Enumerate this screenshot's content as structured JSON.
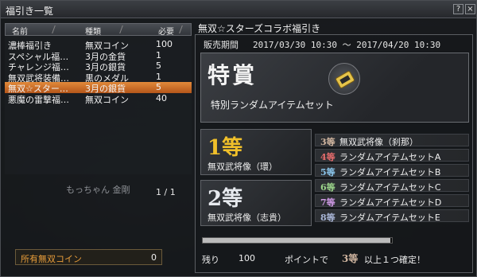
{
  "window": {
    "title": "福引き一覧",
    "help_label": "?",
    "close_label": "×"
  },
  "list": {
    "headers": {
      "name": "名前",
      "type": "種類",
      "required": "必要"
    },
    "rows": [
      {
        "name": "濃棒福引き",
        "type": "無双コイン",
        "required": "100",
        "selected": false
      },
      {
        "name": "スペシャル福…",
        "type": "3月の金貨",
        "required": "1",
        "selected": false
      },
      {
        "name": "チャレンジ福…",
        "type": "3月の銀貨",
        "required": "5",
        "selected": false
      },
      {
        "name": "無双武将装備…",
        "type": "黒のメダル",
        "required": "1",
        "selected": false
      },
      {
        "name": "無双☆スター…",
        "type": "3月の銀貨",
        "required": "5",
        "selected": true
      },
      {
        "name": "悪魔の雷撃福…",
        "type": "無双コイン",
        "required": "40",
        "selected": false
      }
    ],
    "pager": "1 / 1",
    "background_text": "もっちゃん 金剛"
  },
  "coins": {
    "label": "所有無双コイン",
    "value": "0"
  },
  "detail": {
    "title": "無双☆スターズコラボ福引き",
    "period_label": "販売期間",
    "period_value": "2017/03/30 10:30 〜 2017/04/20 10:30",
    "special": {
      "title": "特賞",
      "item": "特別ランダムアイテムセット"
    },
    "first": {
      "rank": "1等",
      "item": "無双武将像（環）",
      "color": "#f0c02a"
    },
    "second": {
      "rank": "2等",
      "item": "無双武将像（志貴）",
      "color": "#e6e9ee"
    },
    "subs": [
      {
        "rank": "3等",
        "item": "無双武将像（刹那）",
        "color": "#d1b6a0"
      },
      {
        "rank": "4等",
        "item": "ランダムアイテムセットA",
        "color": "#e56c6c"
      },
      {
        "rank": "5等",
        "item": "ランダムアイテムセットB",
        "color": "#8bc6ec"
      },
      {
        "rank": "6等",
        "item": "ランダムアイテムセットC",
        "color": "#9bd48a"
      },
      {
        "rank": "7等",
        "item": "ランダムアイテムセットD",
        "color": "#cf9ae6"
      },
      {
        "rank": "8等",
        "item": "ランダムアイテムセットE",
        "color": "#a8b5d6"
      }
    ],
    "progress": 0.99,
    "remaining_label": "残り",
    "remaining_value": "100",
    "confirm_text": "ポイントで",
    "confirm_rank": "3等",
    "confirm_suffix": "以上１つ確定！",
    "confirm_rank_color": "#d1b6a0"
  }
}
